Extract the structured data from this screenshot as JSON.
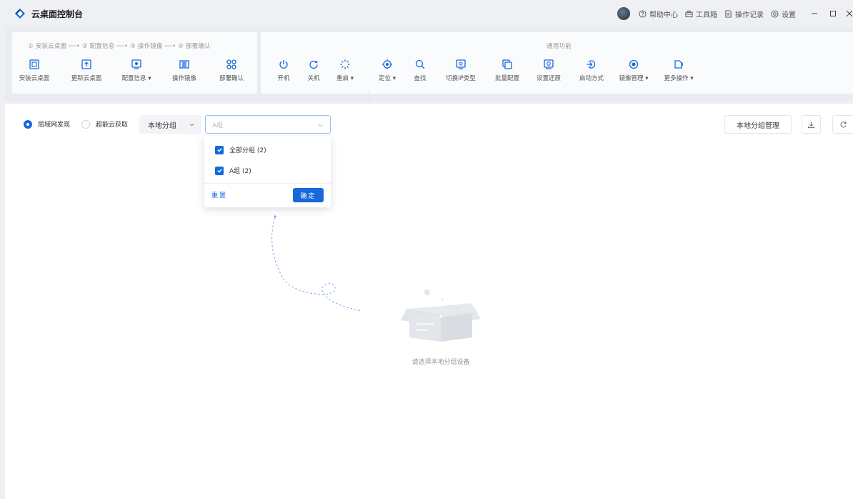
{
  "app": {
    "title": "云桌面控制台"
  },
  "topbar": {
    "links": [
      {
        "icon": "help-circle-icon",
        "label": "帮助中心"
      },
      {
        "icon": "toolbox-icon",
        "label": "工具箱"
      },
      {
        "icon": "log-icon",
        "label": "操作记录"
      },
      {
        "icon": "settings-icon",
        "label": "设置"
      }
    ]
  },
  "toolbar": {
    "steps_title": "① 安装云桌面 ──• ② 配置信息 ──• ③ 操作镜像 ──• ④ 部署确认",
    "common_title": "通用功能",
    "step_buttons": [
      {
        "icon": "install-icon",
        "label": "安装云桌面"
      },
      {
        "icon": "update-icon",
        "label": "更新云桌面"
      },
      {
        "icon": "config-icon",
        "label": "配置信息 ▾"
      },
      {
        "icon": "image-icon",
        "label": "操作镜像"
      },
      {
        "icon": "deploy-icon",
        "label": "部署确认"
      }
    ],
    "common_buttons": [
      {
        "icon": "power-on-icon",
        "label": "开机"
      },
      {
        "icon": "power-off-icon",
        "label": "关机"
      },
      {
        "icon": "restart-icon",
        "label": "重启 ▾"
      },
      {
        "icon": "locate-icon",
        "label": "定位 ▾"
      },
      {
        "icon": "search-icon",
        "label": "查找"
      },
      {
        "icon": "switch-ip-icon",
        "label": "切换IP类型"
      },
      {
        "icon": "batch-config-icon",
        "label": "批量配置"
      },
      {
        "icon": "restore-icon",
        "label": "设置还原"
      },
      {
        "icon": "boot-icon",
        "label": "启动方式"
      },
      {
        "icon": "image-manage-icon",
        "label": "镜像管理 ▾"
      },
      {
        "icon": "more-icon",
        "label": "更多操作 ▾"
      }
    ]
  },
  "filters": {
    "radio_lan": "局域网发现",
    "radio_cloud": "超能云获取",
    "group_select": "本地分组",
    "sub_placeholder": "A组",
    "manage_button": "本地分组管理"
  },
  "dropdown": {
    "options": [
      {
        "label": "全部分组 (2)",
        "checked": true
      },
      {
        "label": "A组 (2)",
        "checked": true
      }
    ],
    "reset": "重置",
    "confirm": "确定"
  },
  "empty_state": {
    "text": "请选择本地分组设备"
  },
  "colors": {
    "accent": "#1668dc",
    "background": "#eef0f4"
  }
}
